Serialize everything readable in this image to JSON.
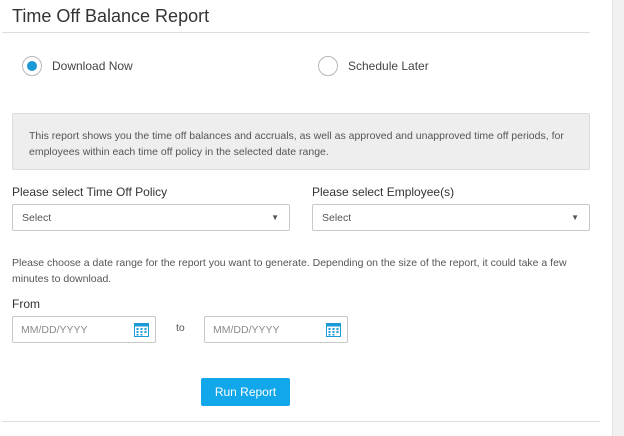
{
  "page": {
    "title": "Time Off Balance Report"
  },
  "delivery": {
    "options": [
      {
        "label": "Download Now",
        "checked": true
      },
      {
        "label": "Schedule Later",
        "checked": false
      }
    ]
  },
  "info": {
    "text": "This report shows you the time off balances and accruals, as well as approved and unapproved time off periods, for employees within each time off policy in the selected date range."
  },
  "filters": {
    "policy": {
      "label": "Please select Time Off Policy",
      "value": "Select"
    },
    "employee": {
      "label": "Please select Employee(s)",
      "value": "Select"
    }
  },
  "date_range": {
    "help": "Please choose a date range for the report you want to generate. Depending on the size of the report, it could take a few minutes to download.",
    "from_label": "From",
    "from_placeholder": "MM/DD/YYYY",
    "to_label": "to",
    "to_placeholder": "MM/DD/YYYY"
  },
  "actions": {
    "run_label": "Run Report"
  },
  "colors": {
    "accent": "#11a7ea",
    "radio_selected": "#1a9ad6",
    "info_bg": "#eeeeee"
  },
  "icons": {
    "dropdown": "caret-down-icon",
    "calendar": "calendar-icon"
  }
}
